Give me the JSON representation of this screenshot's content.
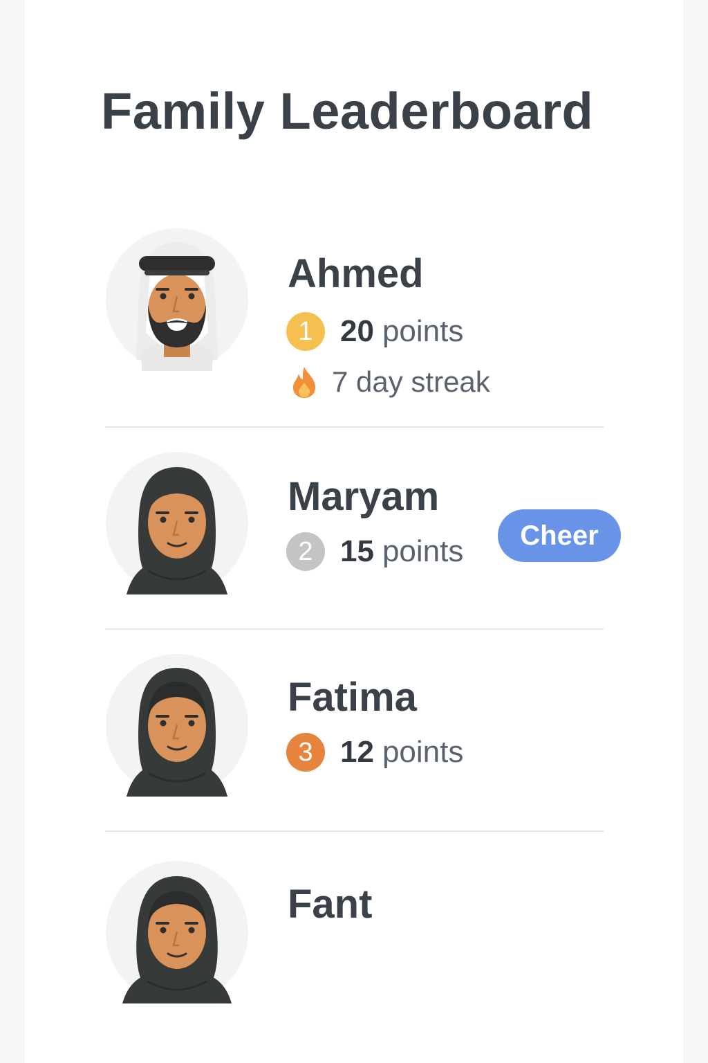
{
  "header": {
    "title": "Family Leaderboard"
  },
  "colors": {
    "gold": "#f5c04f",
    "silver": "#c4c4c4",
    "bronze": "#e6843e",
    "accent": "#6893e6"
  },
  "members": [
    {
      "name": "Ahmed",
      "rank": "1",
      "points": "20",
      "points_unit": "points",
      "streak": "7 day streak",
      "avatar": "ghutra-avatar"
    },
    {
      "name": "Maryam",
      "rank": "2",
      "points": "15",
      "points_unit": "points",
      "avatar": "hijab-avatar",
      "cheer_label": "Cheer"
    },
    {
      "name": "Fatima",
      "rank": "3",
      "points": "12",
      "points_unit": "points",
      "avatar": "hijab-avatar"
    },
    {
      "name": "Fant",
      "avatar": "hijab-avatar"
    }
  ]
}
